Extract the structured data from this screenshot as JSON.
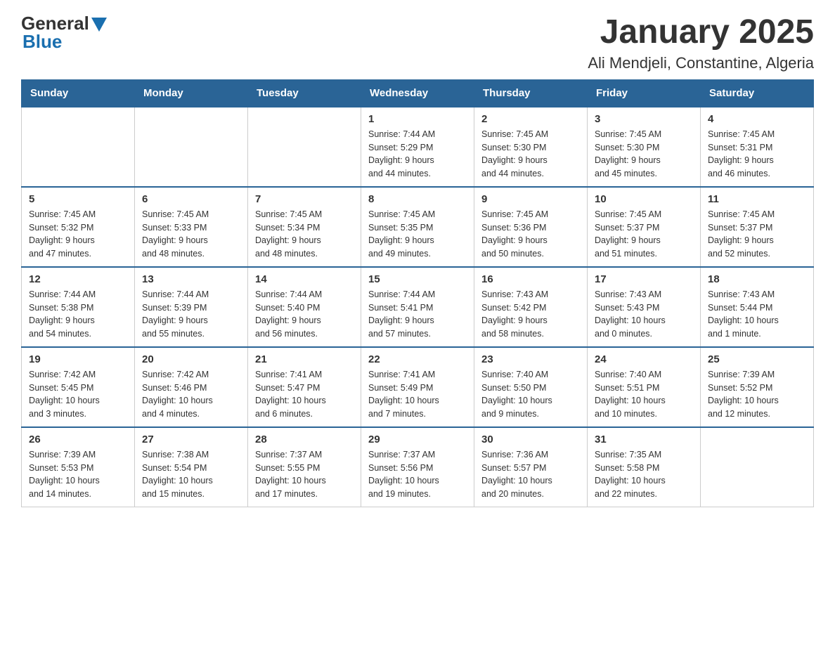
{
  "header": {
    "logo_general": "General",
    "logo_blue": "Blue",
    "title": "January 2025",
    "subtitle": "Ali Mendjeli, Constantine, Algeria"
  },
  "days_of_week": [
    "Sunday",
    "Monday",
    "Tuesday",
    "Wednesday",
    "Thursday",
    "Friday",
    "Saturday"
  ],
  "weeks": [
    [
      {
        "day": "",
        "info": ""
      },
      {
        "day": "",
        "info": ""
      },
      {
        "day": "",
        "info": ""
      },
      {
        "day": "1",
        "info": "Sunrise: 7:44 AM\nSunset: 5:29 PM\nDaylight: 9 hours\nand 44 minutes."
      },
      {
        "day": "2",
        "info": "Sunrise: 7:45 AM\nSunset: 5:30 PM\nDaylight: 9 hours\nand 44 minutes."
      },
      {
        "day": "3",
        "info": "Sunrise: 7:45 AM\nSunset: 5:30 PM\nDaylight: 9 hours\nand 45 minutes."
      },
      {
        "day": "4",
        "info": "Sunrise: 7:45 AM\nSunset: 5:31 PM\nDaylight: 9 hours\nand 46 minutes."
      }
    ],
    [
      {
        "day": "5",
        "info": "Sunrise: 7:45 AM\nSunset: 5:32 PM\nDaylight: 9 hours\nand 47 minutes."
      },
      {
        "day": "6",
        "info": "Sunrise: 7:45 AM\nSunset: 5:33 PM\nDaylight: 9 hours\nand 48 minutes."
      },
      {
        "day": "7",
        "info": "Sunrise: 7:45 AM\nSunset: 5:34 PM\nDaylight: 9 hours\nand 48 minutes."
      },
      {
        "day": "8",
        "info": "Sunrise: 7:45 AM\nSunset: 5:35 PM\nDaylight: 9 hours\nand 49 minutes."
      },
      {
        "day": "9",
        "info": "Sunrise: 7:45 AM\nSunset: 5:36 PM\nDaylight: 9 hours\nand 50 minutes."
      },
      {
        "day": "10",
        "info": "Sunrise: 7:45 AM\nSunset: 5:37 PM\nDaylight: 9 hours\nand 51 minutes."
      },
      {
        "day": "11",
        "info": "Sunrise: 7:45 AM\nSunset: 5:37 PM\nDaylight: 9 hours\nand 52 minutes."
      }
    ],
    [
      {
        "day": "12",
        "info": "Sunrise: 7:44 AM\nSunset: 5:38 PM\nDaylight: 9 hours\nand 54 minutes."
      },
      {
        "day": "13",
        "info": "Sunrise: 7:44 AM\nSunset: 5:39 PM\nDaylight: 9 hours\nand 55 minutes."
      },
      {
        "day": "14",
        "info": "Sunrise: 7:44 AM\nSunset: 5:40 PM\nDaylight: 9 hours\nand 56 minutes."
      },
      {
        "day": "15",
        "info": "Sunrise: 7:44 AM\nSunset: 5:41 PM\nDaylight: 9 hours\nand 57 minutes."
      },
      {
        "day": "16",
        "info": "Sunrise: 7:43 AM\nSunset: 5:42 PM\nDaylight: 9 hours\nand 58 minutes."
      },
      {
        "day": "17",
        "info": "Sunrise: 7:43 AM\nSunset: 5:43 PM\nDaylight: 10 hours\nand 0 minutes."
      },
      {
        "day": "18",
        "info": "Sunrise: 7:43 AM\nSunset: 5:44 PM\nDaylight: 10 hours\nand 1 minute."
      }
    ],
    [
      {
        "day": "19",
        "info": "Sunrise: 7:42 AM\nSunset: 5:45 PM\nDaylight: 10 hours\nand 3 minutes."
      },
      {
        "day": "20",
        "info": "Sunrise: 7:42 AM\nSunset: 5:46 PM\nDaylight: 10 hours\nand 4 minutes."
      },
      {
        "day": "21",
        "info": "Sunrise: 7:41 AM\nSunset: 5:47 PM\nDaylight: 10 hours\nand 6 minutes."
      },
      {
        "day": "22",
        "info": "Sunrise: 7:41 AM\nSunset: 5:49 PM\nDaylight: 10 hours\nand 7 minutes."
      },
      {
        "day": "23",
        "info": "Sunrise: 7:40 AM\nSunset: 5:50 PM\nDaylight: 10 hours\nand 9 minutes."
      },
      {
        "day": "24",
        "info": "Sunrise: 7:40 AM\nSunset: 5:51 PM\nDaylight: 10 hours\nand 10 minutes."
      },
      {
        "day": "25",
        "info": "Sunrise: 7:39 AM\nSunset: 5:52 PM\nDaylight: 10 hours\nand 12 minutes."
      }
    ],
    [
      {
        "day": "26",
        "info": "Sunrise: 7:39 AM\nSunset: 5:53 PM\nDaylight: 10 hours\nand 14 minutes."
      },
      {
        "day": "27",
        "info": "Sunrise: 7:38 AM\nSunset: 5:54 PM\nDaylight: 10 hours\nand 15 minutes."
      },
      {
        "day": "28",
        "info": "Sunrise: 7:37 AM\nSunset: 5:55 PM\nDaylight: 10 hours\nand 17 minutes."
      },
      {
        "day": "29",
        "info": "Sunrise: 7:37 AM\nSunset: 5:56 PM\nDaylight: 10 hours\nand 19 minutes."
      },
      {
        "day": "30",
        "info": "Sunrise: 7:36 AM\nSunset: 5:57 PM\nDaylight: 10 hours\nand 20 minutes."
      },
      {
        "day": "31",
        "info": "Sunrise: 7:35 AM\nSunset: 5:58 PM\nDaylight: 10 hours\nand 22 minutes."
      },
      {
        "day": "",
        "info": ""
      }
    ]
  ]
}
